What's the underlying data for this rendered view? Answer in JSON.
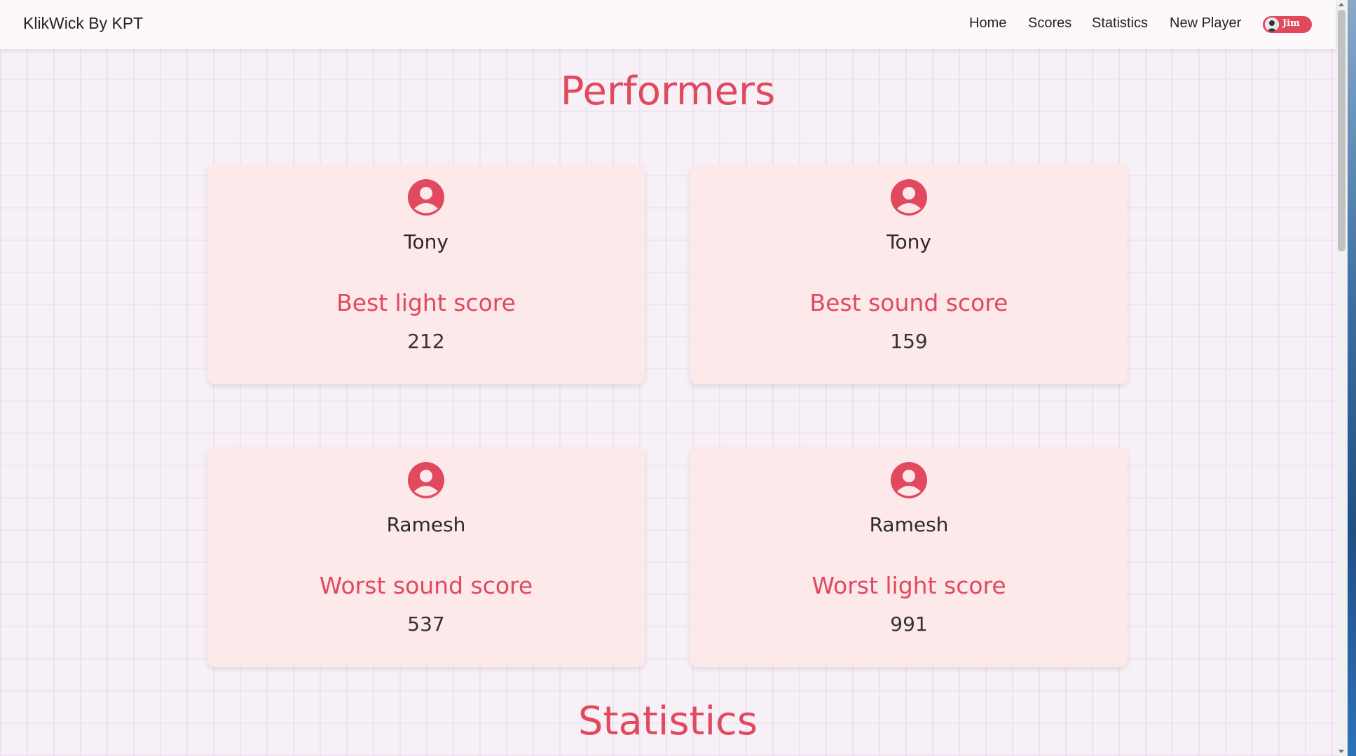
{
  "navbar": {
    "brand": "KlikWick By KPT",
    "links": [
      "Home",
      "Scores",
      "Statistics",
      "New Player"
    ],
    "user": {
      "name": "Jim"
    }
  },
  "sections": {
    "performers_title": "Performers",
    "statistics_title": "Statistics"
  },
  "cards": [
    {
      "name": "Tony",
      "label": "Best light score",
      "value": "212"
    },
    {
      "name": "Tony",
      "label": "Best sound score",
      "value": "159"
    },
    {
      "name": "Ramesh",
      "label": "Worst sound score",
      "value": "537"
    },
    {
      "name": "Ramesh",
      "label": "Worst light score",
      "value": "991"
    }
  ],
  "colors": {
    "accent": "#e0495e",
    "card_bg": "#fde8ea",
    "page_bg": "#f7f0f7"
  }
}
